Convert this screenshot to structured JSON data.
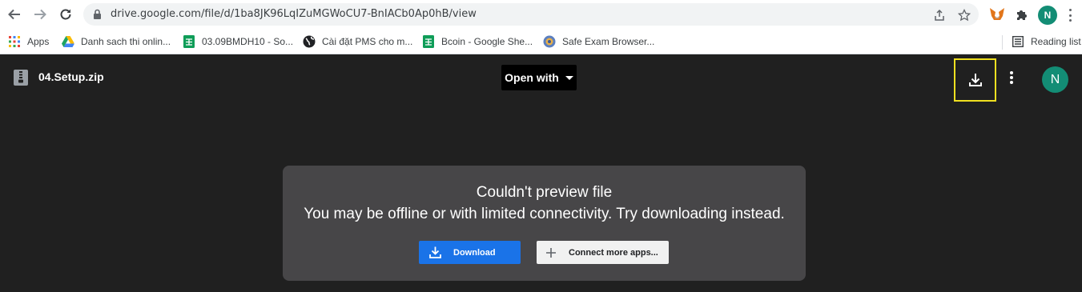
{
  "browser": {
    "url": "drive.google.com/file/d/1ba8JK96LqIZuMGWoCU7-BnIACb0Ap0hB/view",
    "profile_initial": "N",
    "reading_list_label": "Reading list"
  },
  "bookmarks": [
    {
      "label": "Apps",
      "icon": "apps-grid-icon"
    },
    {
      "label": "Danh sach thi onlin...",
      "icon": "google-drive-icon"
    },
    {
      "label": "03.09BMDH10 - So...",
      "icon": "google-sheets-icon"
    },
    {
      "label": "Cài đặt PMS cho m...",
      "icon": "globe-icon"
    },
    {
      "label": "Bcoin - Google She...",
      "icon": "google-sheets-icon"
    },
    {
      "label": "Safe Exam Browser...",
      "icon": "safe-exam-browser-icon"
    }
  ],
  "viewer": {
    "file_name": "04.Setup.zip",
    "open_with_label": "Open with",
    "avatar_initial": "N"
  },
  "preview": {
    "title": "Couldn't preview file",
    "message": "You may be offline or with limited connectivity. Try downloading instead.",
    "download_label": "Download",
    "connect_label": "Connect more apps..."
  },
  "colors": {
    "viewer_bg": "#202020",
    "card_bg": "#474648",
    "download_blue": "#1a73e8",
    "highlight_yellow": "#f0e020",
    "avatar_teal": "#138d75"
  }
}
